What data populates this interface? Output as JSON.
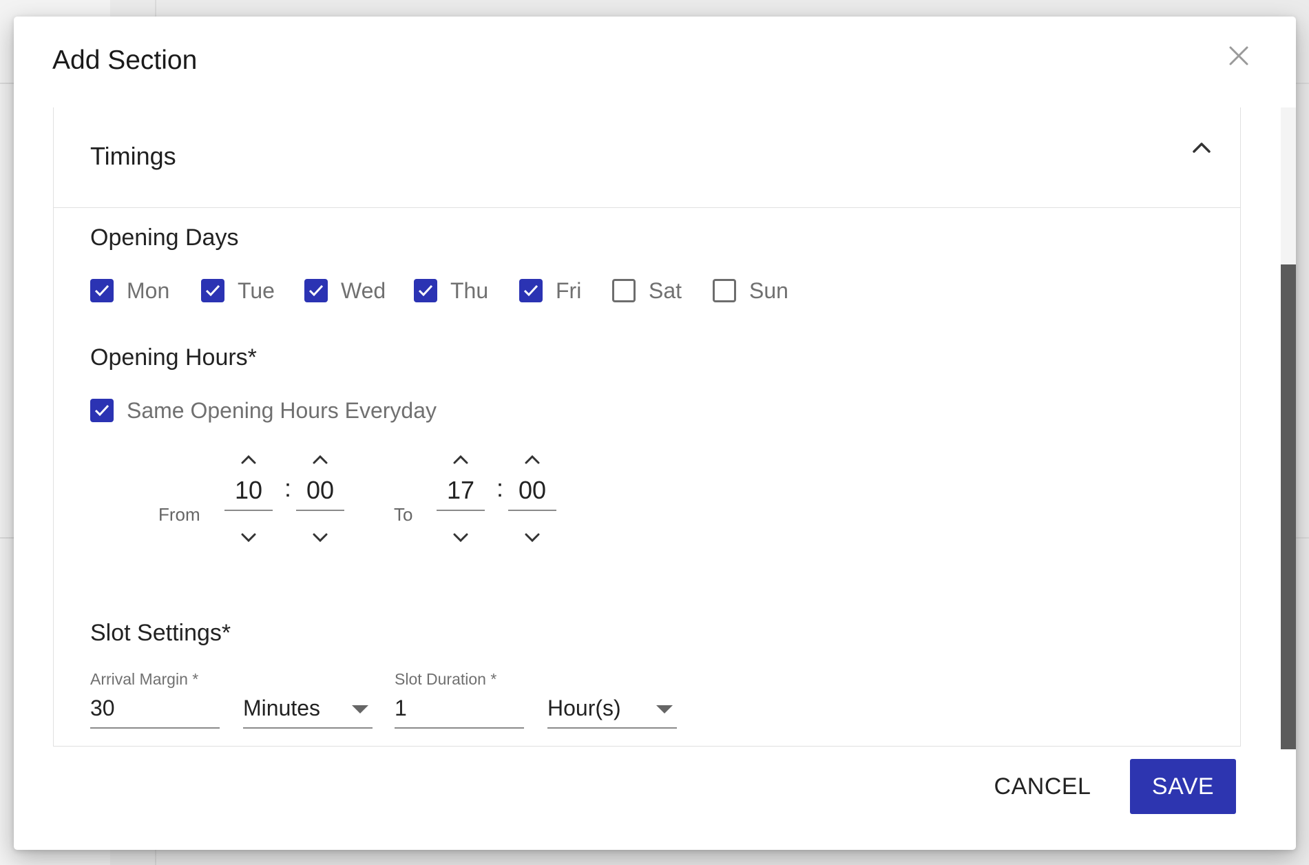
{
  "dialog": {
    "title": "Add Section",
    "close_icon": "close-icon"
  },
  "section": {
    "title": "Timings",
    "collapse_icon": "chevron-up-icon"
  },
  "opening_days": {
    "heading": "Opening Days",
    "days": [
      {
        "label": "Mon",
        "checked": true
      },
      {
        "label": "Tue",
        "checked": true
      },
      {
        "label": "Wed",
        "checked": true
      },
      {
        "label": "Thu",
        "checked": true
      },
      {
        "label": "Fri",
        "checked": true
      },
      {
        "label": "Sat",
        "checked": false
      },
      {
        "label": "Sun",
        "checked": false
      }
    ]
  },
  "opening_hours": {
    "heading": "Opening Hours*",
    "same_everyday_label": "Same Opening Hours Everyday",
    "same_everyday_checked": true,
    "from_label": "From",
    "to_label": "To",
    "from_hour": "10",
    "from_minute": "00",
    "to_hour": "17",
    "to_minute": "00",
    "separator": ":"
  },
  "slot_settings": {
    "heading": "Slot Settings*",
    "arrival_margin_label": "Arrival Margin *",
    "arrival_margin_value": "30",
    "arrival_margin_unit": "Minutes",
    "slot_duration_label": "Slot Duration *",
    "slot_duration_value": "1",
    "slot_duration_unit": "Hour(s)"
  },
  "actions": {
    "cancel_label": "CANCEL",
    "save_label": "SAVE"
  },
  "colors": {
    "accent": "#2d35b0",
    "checkbox": "#2b33b3"
  }
}
